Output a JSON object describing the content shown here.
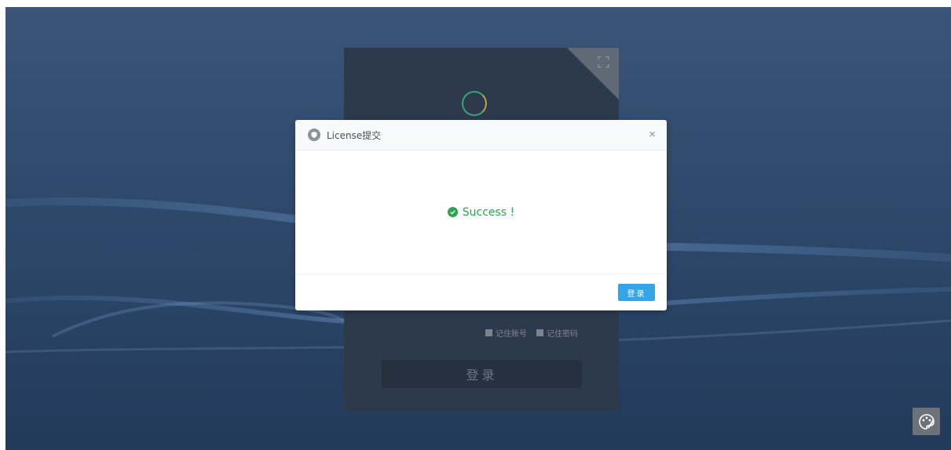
{
  "login_panel": {
    "remember_account": "记住账号",
    "remember_password": "记住密码",
    "login_label": "登录"
  },
  "modal": {
    "title": "License提交",
    "close_label": "×",
    "message": "Success !",
    "login_button_label": "登录"
  },
  "icons": {
    "modal_header": "shield-icon",
    "message": "check-circle-icon",
    "corner": "fullscreen-icon",
    "floating": "palette-icon"
  },
  "colors": {
    "success": "#2ba34f",
    "primary_button": "#35a5e8"
  }
}
